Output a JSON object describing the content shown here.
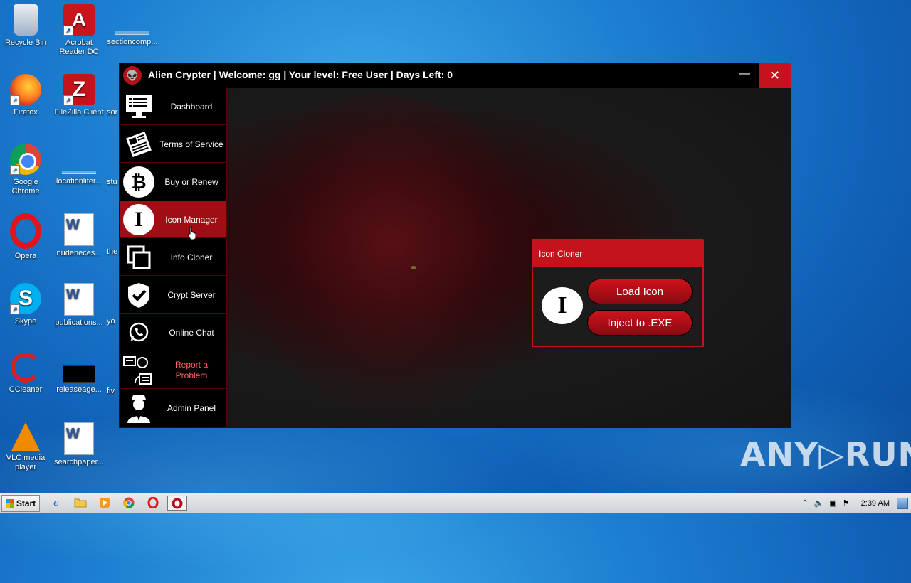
{
  "desktop": {
    "icons": [
      {
        "label": "Recycle Bin",
        "icon": "recycle-bin-icon"
      },
      {
        "label": "Acrobat Reader DC",
        "icon": "acrobat-icon"
      },
      {
        "label": "sectioncomp...",
        "icon": "file-icon"
      },
      {
        "label": "Firefox",
        "icon": "firefox-icon"
      },
      {
        "label": "FileZilla Client",
        "icon": "filezilla-icon"
      },
      {
        "label": "Google Chrome",
        "icon": "chrome-icon"
      },
      {
        "label": "locationliter...",
        "icon": "file-icon"
      },
      {
        "label": "Opera",
        "icon": "opera-icon"
      },
      {
        "label": "nudeneces...",
        "icon": "word-doc-icon"
      },
      {
        "label": "Skype",
        "icon": "skype-icon"
      },
      {
        "label": "publications...",
        "icon": "word-doc-icon"
      },
      {
        "label": "CCleaner",
        "icon": "ccleaner-icon"
      },
      {
        "label": "releaseage...",
        "icon": "file-icon"
      },
      {
        "label": "VLC media player",
        "icon": "vlc-icon"
      },
      {
        "label": "searchpaper...",
        "icon": "word-doc-icon"
      },
      {
        "label": "sor",
        "icon": "file-icon"
      },
      {
        "label": "stu",
        "icon": "file-icon"
      },
      {
        "label": "the",
        "icon": "file-icon"
      },
      {
        "label": "yo",
        "icon": "file-icon"
      },
      {
        "label": "fiv",
        "icon": "file-icon"
      }
    ]
  },
  "app": {
    "title": "Alien Crypter | Welcome: gg | Your level: Free User | Days Left: 0",
    "logo_glyph": "👽",
    "minimize_glyph": "—",
    "close_glyph": "✕",
    "accent": "#c4131c",
    "nav": [
      {
        "label": "Dashboard",
        "icon": "monitor-icon"
      },
      {
        "label": "Terms of Service",
        "icon": "newspaper-icon"
      },
      {
        "label": "Buy or Renew",
        "icon": "bitcoin-icon",
        "glyph": "₿"
      },
      {
        "label": "Icon Manager",
        "icon": "info-i-icon",
        "glyph": "I",
        "active": true
      },
      {
        "label": "Info Cloner",
        "icon": "copy-icon"
      },
      {
        "label": "Crypt Server",
        "icon": "shield-check-icon"
      },
      {
        "label": "Online Chat",
        "icon": "whatsapp-icon"
      },
      {
        "label": "Report a Problem",
        "icon": "support-agent-icon"
      },
      {
        "label": "Admin Panel",
        "icon": "admin-person-icon"
      }
    ]
  },
  "dialog": {
    "title": "Icon Cloner",
    "icon_glyph": "I",
    "load_label": "Load Icon",
    "inject_label": "Inject to .EXE"
  },
  "watermark": "ANY▷RUN",
  "taskbar": {
    "start_label": "Start",
    "clock": "2:39 AM",
    "items": [
      "internet-explorer-icon",
      "folder-icon",
      "media-player-icon",
      "chrome-icon",
      "opera-icon",
      "alien-crypter-icon"
    ]
  }
}
